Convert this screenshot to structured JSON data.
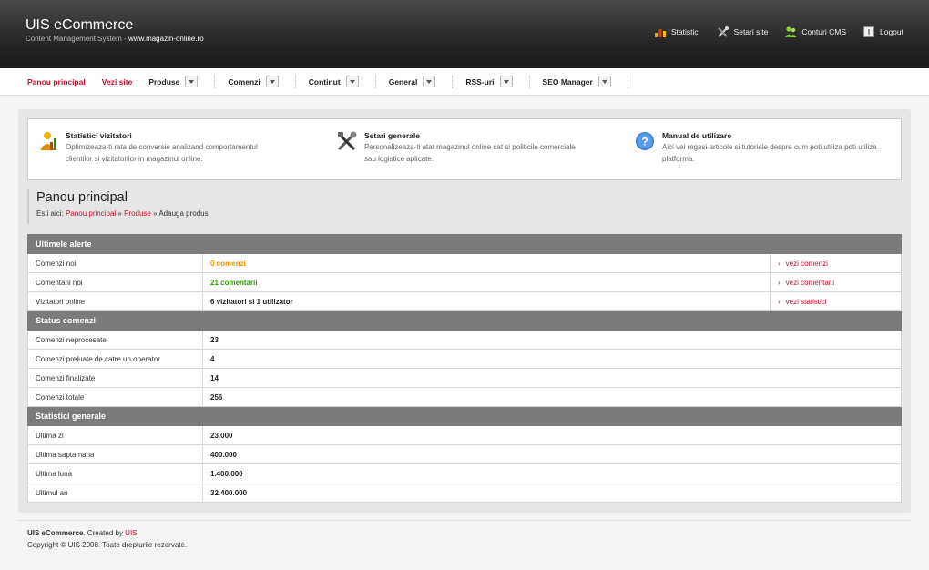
{
  "header": {
    "title": "UIS eCommerce",
    "subtitle": "Content Management System - ",
    "site": "www.magazin-online.ro",
    "links": [
      {
        "label": "Statistici",
        "icon": "stats-icon"
      },
      {
        "label": "Setari site",
        "icon": "tools-icon"
      },
      {
        "label": "Conturi CMS",
        "icon": "users-icon"
      },
      {
        "label": "Logout",
        "icon": "logout-icon"
      }
    ]
  },
  "nav": {
    "items": [
      {
        "label": "Panou principal",
        "dropdown": false,
        "accent": true
      },
      {
        "label": "Vezi site",
        "dropdown": false,
        "accent": true
      },
      {
        "label": "Produse",
        "dropdown": true
      },
      {
        "label": "Comenzi",
        "dropdown": true
      },
      {
        "label": "Continut",
        "dropdown": true
      },
      {
        "label": "General",
        "dropdown": true
      },
      {
        "label": "RSS-uri",
        "dropdown": true
      },
      {
        "label": "SEO Manager",
        "dropdown": true
      }
    ]
  },
  "info": [
    {
      "title": "Statistici vizitatori",
      "text": "Optimizeaza-ti rata de conversie analizand comportamentul clientilor si vizitatorilor in magazinul online."
    },
    {
      "title": "Setari generale",
      "text": "Personalizeaza-ti atat magazinul online cat si politicile comerciale sau logistice aplicate."
    },
    {
      "title": "Manual de utilizare",
      "text": "Aici vei regasi articole si tutoriale despre cum poti utiliza poti utiliza platforma."
    }
  ],
  "page": {
    "title": "Panou principal",
    "crumb_prefix": "Esti aici: ",
    "crumb1": "Panou principal",
    "crumb2": "Produse",
    "crumb3": "Adauga produs",
    "sep": " » "
  },
  "alerts": {
    "heading": "Ultimele alerte",
    "rows": [
      {
        "label": "Comenzi noi",
        "value": "0 comenzi",
        "link": "vezi comenzi"
      },
      {
        "label": "Comentarii noi",
        "value": "21 comentarii",
        "link": "vezi comentarii"
      },
      {
        "label": "Vizitatori online",
        "value": "6 vizitatori si 1 utilizator",
        "link": "vezi statistici"
      }
    ]
  },
  "orders": {
    "heading": "Status comenzi",
    "rows": [
      {
        "label": "Comenzi neprocesate",
        "value": "23"
      },
      {
        "label": "Comenzi preluate de catre un operator",
        "value": "4"
      },
      {
        "label": "Comenzi finalizate",
        "value": "14"
      },
      {
        "label": "Comenzi totale",
        "value": "256"
      }
    ]
  },
  "stats": {
    "heading": "Statistici generale",
    "rows": [
      {
        "label": "Ultima zi",
        "value": "23.000"
      },
      {
        "label": "Ultima saptamana",
        "value": "400.000"
      },
      {
        "label": "Ultima luna",
        "value": "1.400.000"
      },
      {
        "label": "Ultimul an",
        "value": "32.400.000"
      }
    ]
  },
  "footer": {
    "brand": "UIS eCommerce",
    "created": ". Created by ",
    "author": "UIS",
    "dot": ".",
    "copyright": "Copyright © UIS 2008. Toate drepturile rezervate."
  },
  "colors": {
    "accent": "#c8102e",
    "orange": "#f39200",
    "green": "#2e9e00",
    "section": "#7b7b7b"
  }
}
